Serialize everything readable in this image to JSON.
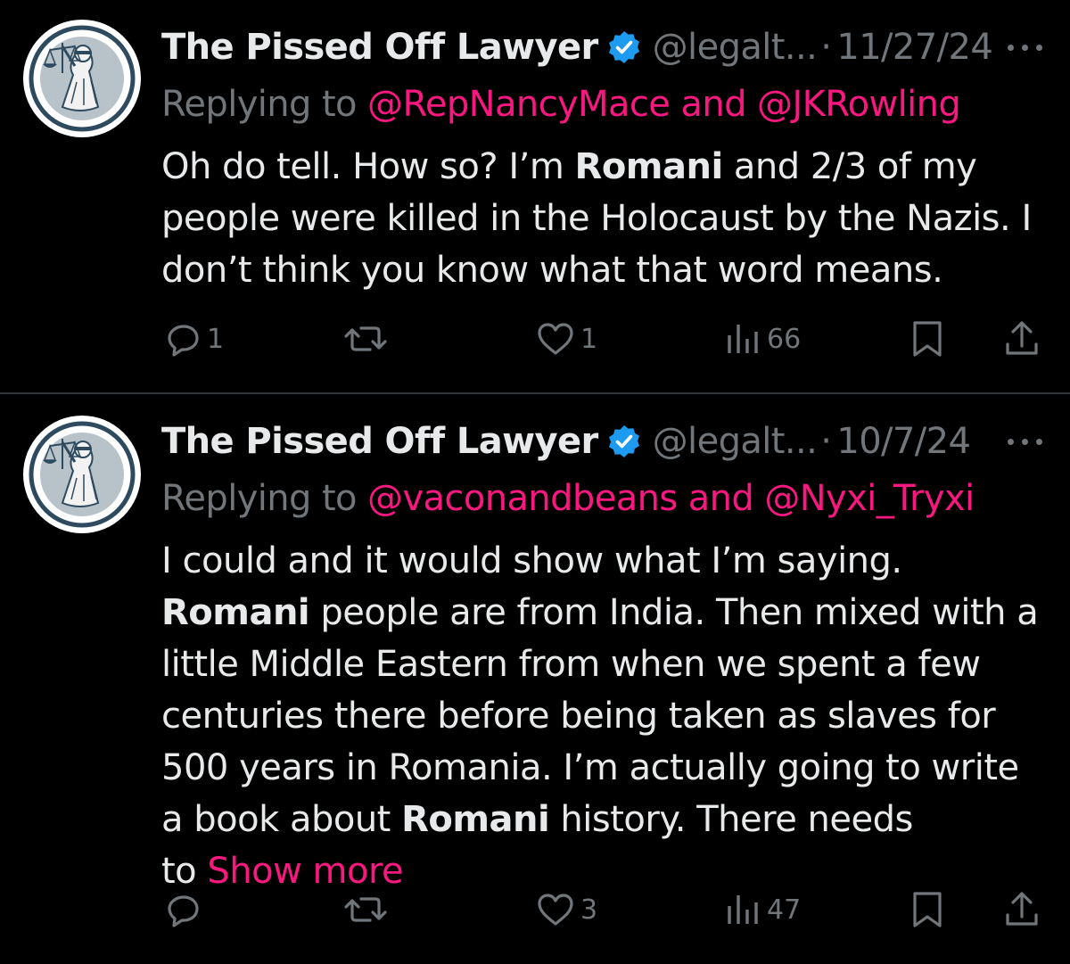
{
  "colors": {
    "background": "#000000",
    "text": "#e7e9ea",
    "secondary": "#71767b",
    "accent_link": "#f91880",
    "verified": "#1d9bf0",
    "divider": "#2f3336"
  },
  "tweets": [
    {
      "author": {
        "name": "The Pissed Off Lawyer",
        "handle": "@legalt...",
        "verified_icon": "verified-badge-icon",
        "avatar_icon": "lady-justice-avatar"
      },
      "separator": "·",
      "date": "11/27/24",
      "more_icon": "ellipsis-icon",
      "replying_prefix": "Replying to",
      "replying_to_1": "@RepNancyMace",
      "replying_and": "and",
      "replying_to_2": "@JKRowling",
      "lines": [
        {
          "pre": "Oh do tell. How so? I’m ",
          "bold": "Romani",
          "post": " and 2/3 of my"
        },
        {
          "pre": "people were killed in the Holocaust by the Nazis. I",
          "bold": "",
          "post": ""
        },
        {
          "pre": "don’t think you know what that word means.",
          "bold": "",
          "post": ""
        }
      ],
      "show_more": "",
      "actions": {
        "reply_count": "1",
        "retweet_count": "",
        "like_count": "1",
        "views_count": "66"
      }
    },
    {
      "author": {
        "name": "The Pissed Off Lawyer",
        "handle": "@legalt...",
        "verified_icon": "verified-badge-icon",
        "avatar_icon": "lady-justice-avatar"
      },
      "separator": "·",
      "date": "10/7/24",
      "more_icon": "ellipsis-icon",
      "replying_prefix": "Replying to",
      "replying_to_1": "@vaconandbeans",
      "replying_and": "and",
      "replying_to_2": "@Nyxi_Tryxi",
      "lines": [
        {
          "pre": "I could and it would show what I’m saying.",
          "bold": "",
          "post": ""
        },
        {
          "pre": "",
          "bold": "Romani",
          "post": " people are from India. Then mixed with a"
        },
        {
          "pre": "little Middle Eastern from when we spent a few",
          "bold": "",
          "post": ""
        },
        {
          "pre": "centuries there before being taken as slaves for",
          "bold": "",
          "post": ""
        },
        {
          "pre": "500 years in Romania. I’m actually going to write",
          "bold": "",
          "post": ""
        },
        {
          "pre": "a book about ",
          "bold": "Romani",
          "post": " history. There needs"
        },
        {
          "pre": "to ",
          "bold": "",
          "post": ""
        }
      ],
      "show_more": "Show more",
      "actions": {
        "reply_count": "",
        "retweet_count": "",
        "like_count": "3",
        "views_count": "47"
      }
    }
  ]
}
